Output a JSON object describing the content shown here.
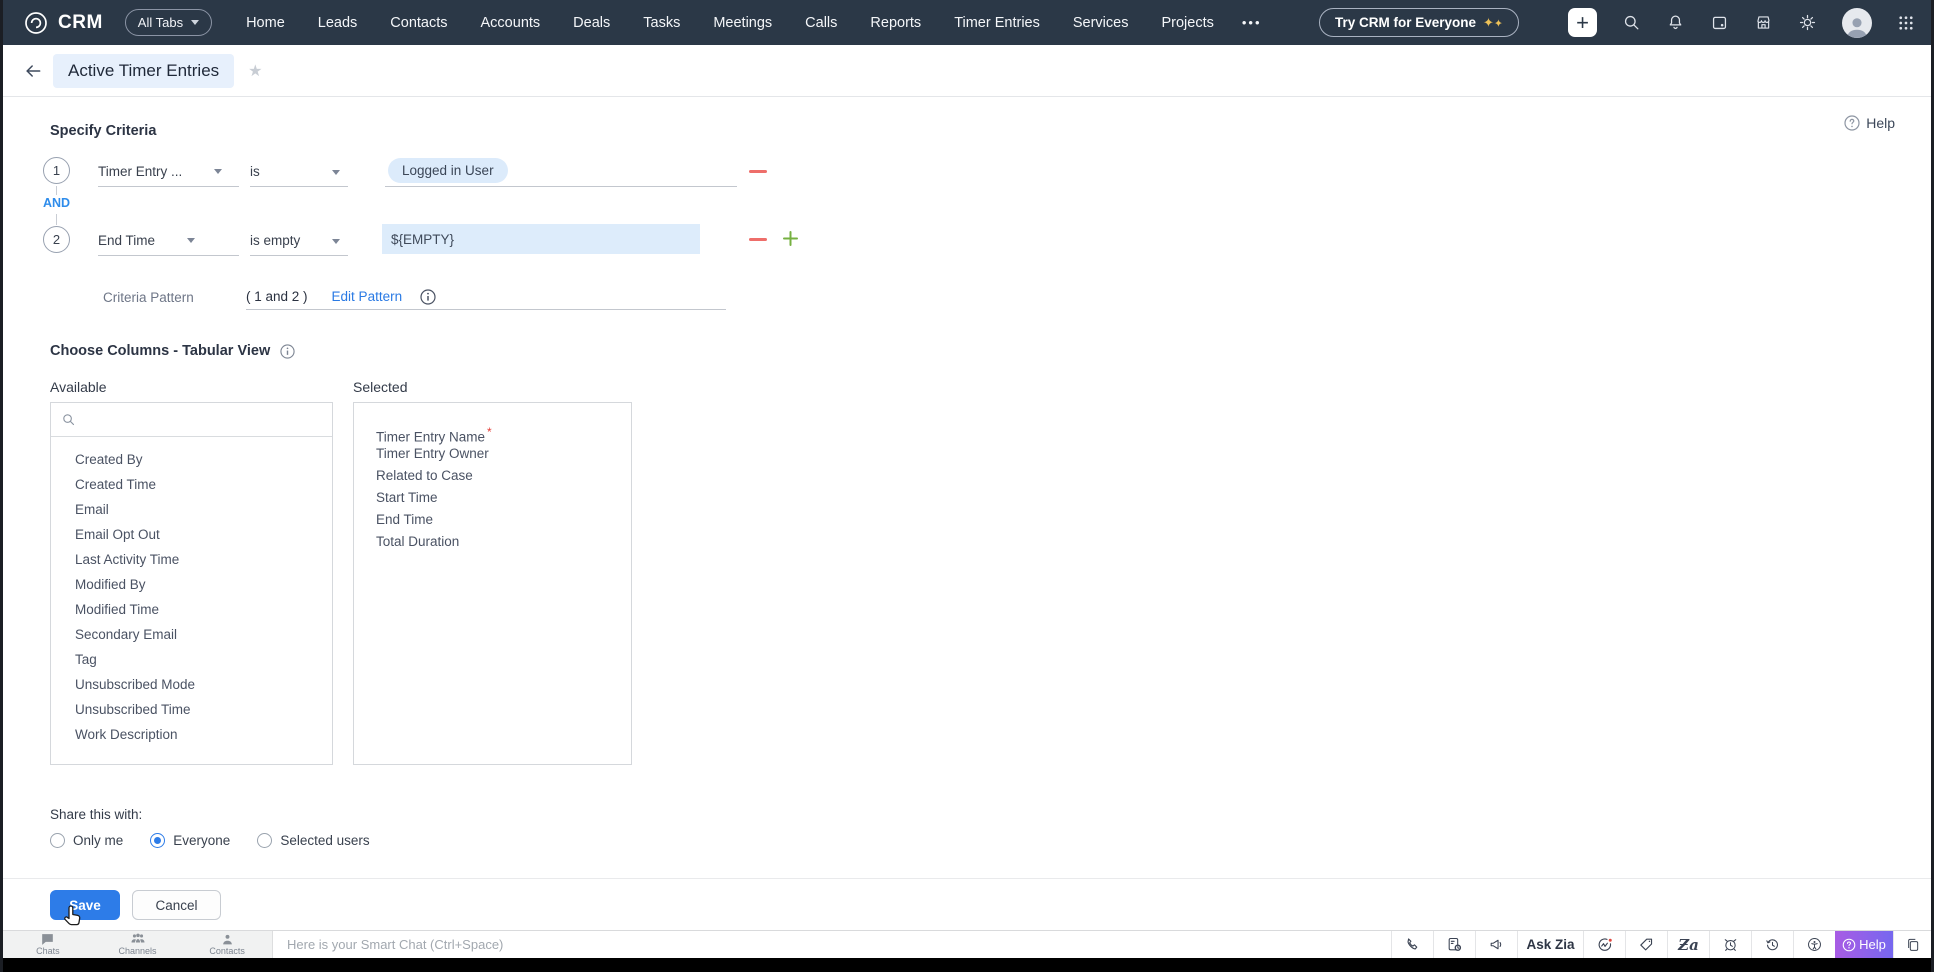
{
  "topnav": {
    "brand": "CRM",
    "all_tabs": "All Tabs",
    "items": [
      "Home",
      "Leads",
      "Contacts",
      "Accounts",
      "Deals",
      "Tasks",
      "Meetings",
      "Calls",
      "Reports",
      "Timer Entries",
      "Services",
      "Projects"
    ],
    "more": "•••",
    "try_label": "Try CRM for Everyone",
    "icons": [
      "plus-icon",
      "search-icon",
      "bell-icon",
      "calendar-icon",
      "store-icon",
      "gear-icon",
      "avatar",
      "apps-grid-icon"
    ],
    "bar_color": "#2b3847"
  },
  "header": {
    "title": "Active Timer Entries",
    "help": "Help"
  },
  "criteria": {
    "section_title": "Specify Criteria",
    "conjunction": "AND",
    "rows": [
      {
        "num": "1",
        "field": "Timer Entry ...",
        "operator": "is",
        "value": "Logged in User"
      },
      {
        "num": "2",
        "field": "End Time",
        "operator": "is empty",
        "value": "${EMPTY}"
      }
    ],
    "pattern_label": "Criteria Pattern",
    "pattern_value": "( 1 and 2 )",
    "edit_pattern": "Edit Pattern"
  },
  "columns": {
    "section_title": "Choose Columns - Tabular View",
    "available_label": "Available",
    "selected_label": "Selected",
    "required_marker": "*",
    "available": [
      "Created By",
      "Created Time",
      "Email",
      "Email Opt Out",
      "Last Activity Time",
      "Modified By",
      "Modified Time",
      "Secondary Email",
      "Tag",
      "Unsubscribed Mode",
      "Unsubscribed Time",
      "Work Description"
    ],
    "selected": [
      {
        "label": "Timer Entry Name",
        "required": true
      },
      {
        "label": "Timer Entry Owner",
        "required": false
      },
      {
        "label": "Related to Case",
        "required": false
      },
      {
        "label": "Start Time",
        "required": false
      },
      {
        "label": "End Time",
        "required": false
      },
      {
        "label": "Total Duration",
        "required": false
      }
    ]
  },
  "share": {
    "label": "Share this with:",
    "options": [
      {
        "label": "Only me",
        "checked": false
      },
      {
        "label": "Everyone",
        "checked": true
      },
      {
        "label": "Selected users",
        "checked": false
      }
    ]
  },
  "actions": {
    "save": "Save",
    "cancel": "Cancel"
  },
  "bottombar": {
    "tabs": [
      {
        "label": "Chats"
      },
      {
        "label": "Channels"
      },
      {
        "label": "Contacts"
      }
    ],
    "chat_placeholder": "Here is your Smart Chat (Ctrl+Space)",
    "ask_zia": "Ask Zia",
    "help": "Help",
    "icons": [
      "phone-icon",
      "call-log-icon",
      "announcement-icon",
      "insights-icon",
      "tag-icon",
      "zia-signature-icon",
      "alarm-icon",
      "history-icon",
      "accessibility-icon",
      "help-icon",
      "copy-icon"
    ]
  },
  "colors": {
    "topbar": "#2b3847",
    "accent_blue": "#2d7ce8",
    "link_blue": "#2a7ae4",
    "and_blue": "#2e8ceb",
    "danger_red": "#ee6e6a",
    "success_green": "#76b041",
    "chip_blue_bg": "#dcebfb",
    "empty_box_bg": "#ddecfb",
    "title_chip_bg": "#e7f0fc",
    "help_gradient": [
      "#a85ce4",
      "#7667ef"
    ]
  }
}
